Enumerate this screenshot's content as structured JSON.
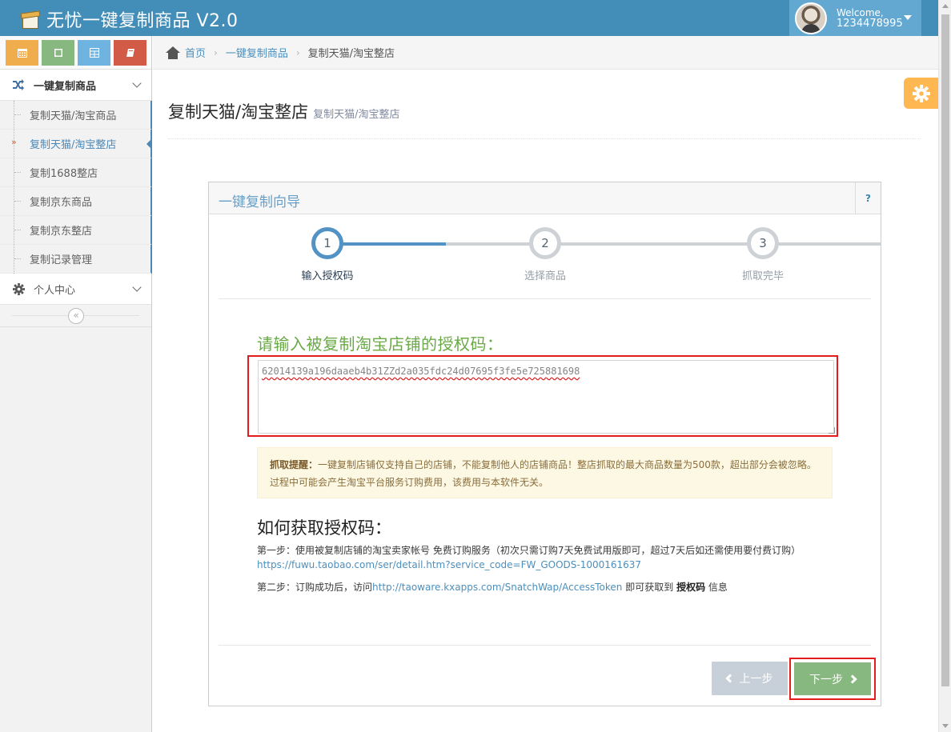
{
  "app": {
    "title": "无忧一键复制商品 V2.0"
  },
  "user": {
    "welcome": "Welcome,",
    "id": "1234478995"
  },
  "shortcuts": [
    {
      "icon": "calendar-icon",
      "color": "#f0ad4e"
    },
    {
      "icon": "square-icon",
      "color": "#87b87f"
    },
    {
      "icon": "grid-icon",
      "color": "#6fb3e0"
    },
    {
      "icon": "book-icon",
      "color": "#d15b47"
    }
  ],
  "sidebar": {
    "group1": {
      "label": "一键复制商品",
      "icon": "shuffle-icon"
    },
    "items": [
      {
        "label": "复制天猫/淘宝商品"
      },
      {
        "label": "复制天猫/淘宝整店",
        "active_marker": "»"
      },
      {
        "label": "复制1688整店"
      },
      {
        "label": "复制京东商品"
      },
      {
        "label": "复制京东整店"
      },
      {
        "label": "复制记录管理"
      }
    ],
    "group2": {
      "label": "个人中心",
      "icon": "gear-icon"
    },
    "collapse_glyph": "«"
  },
  "breadcrumb": {
    "home": "首页",
    "level1": "一键复制商品",
    "current": "复制天猫/淘宝整店",
    "separator": "›"
  },
  "page": {
    "title": "复制天猫/淘宝整店",
    "subtitle": "复制天猫/淘宝整店"
  },
  "wizard": {
    "title": "一键复制向导",
    "help": "?",
    "steps": [
      {
        "num": "1",
        "label": "输入授权码",
        "active": true
      },
      {
        "num": "2",
        "label": "选择商品",
        "active": false
      },
      {
        "num": "3",
        "label": "抓取完毕",
        "active": false
      }
    ],
    "auth_label": "请输入被复制淘宝店铺的授权码：",
    "auth_value": "62014139a196daaeb4b31ZZd2a035fdc24d07695f3fe5e725881698",
    "alert_title": "抓取提醒：",
    "alert_text": "一键复制店铺仅支持自己的店铺，不能复制他人的店铺商品！整店抓取的最大商品数量为500款，超出部分会被忽略。过程中可能会产生淘宝平台服务订购费用，该费用与本软件无关。",
    "howto_title": "如何获取授权码：",
    "howto_step1": "第一步：使用被复制店铺的淘宝卖家帐号 免费订购服务（初次只需订购7天免费试用版即可，超过7天后如还需使用要付费订购）",
    "howto_link1": "https://fuwu.taobao.com/ser/detail.htm?service_code=FW_GOODS-1000161637",
    "howto_step2_prefix": "第二步：订购成功后，访问",
    "howto_link2": "http://taoware.kxapps.com/SnatchWap/AccessToken",
    "howto_step2_mid": " 即可获取到 ",
    "howto_step2_bold": "授权码",
    "howto_step2_suffix": " 信息",
    "prev_label": "上一步",
    "next_label": "下一步"
  }
}
